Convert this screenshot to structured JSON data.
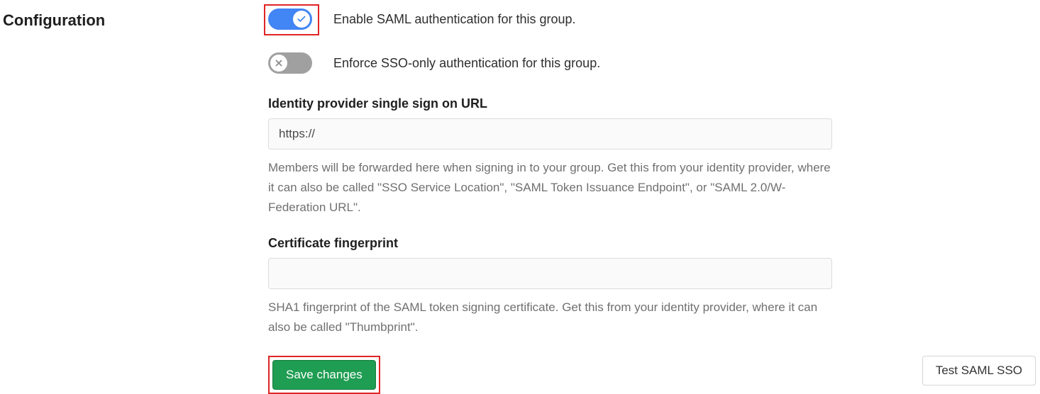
{
  "section": {
    "title": "Configuration"
  },
  "toggles": {
    "enable_saml": {
      "label": "Enable SAML authentication for this group.",
      "state": "on"
    },
    "enforce_sso": {
      "label": "Enforce SSO-only authentication for this group.",
      "state": "off"
    }
  },
  "fields": {
    "idp_url": {
      "label": "Identity provider single sign on URL",
      "value": "https://",
      "help": "Members will be forwarded here when signing in to your group. Get this from your identity provider, where it can also be called \"SSO Service Location\", \"SAML Token Issuance Endpoint\", or \"SAML 2.0/W-Federation URL\"."
    },
    "cert_fingerprint": {
      "label": "Certificate fingerprint",
      "value": "",
      "help": "SHA1 fingerprint of the SAML token signing certificate. Get this from your identity provider, where it can also be called \"Thumbprint\"."
    }
  },
  "buttons": {
    "save": "Save changes",
    "test": "Test SAML SSO"
  }
}
